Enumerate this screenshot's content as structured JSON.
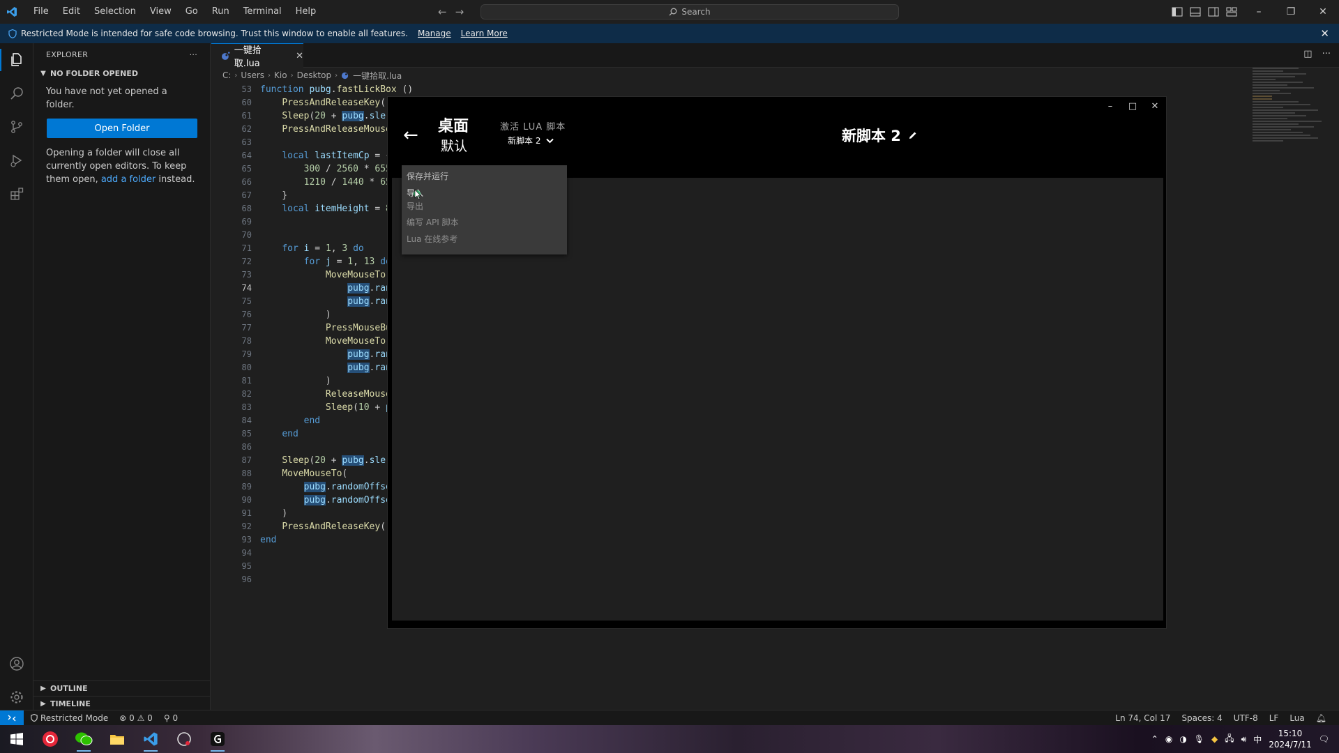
{
  "titlebar": {
    "menu": [
      "File",
      "Edit",
      "Selection",
      "View",
      "Go",
      "Run",
      "Terminal",
      "Help"
    ],
    "search_placeholder": "Search"
  },
  "banner": {
    "text": "Restricted Mode is intended for safe code browsing. Trust this window to enable all features.",
    "manage": "Manage",
    "learn_more": "Learn More"
  },
  "sidebar": {
    "title": "EXPLORER",
    "section": "NO FOLDER OPENED",
    "message": "You have not yet opened a folder.",
    "open_folder": "Open Folder",
    "note_before": "Opening a folder will close all currently open editors. To keep them open, ",
    "note_link": "add a folder",
    "note_after": " instead.",
    "outline": "OUTLINE",
    "timeline": "TIMELINE"
  },
  "editor": {
    "tab_label": "一键拾取.lua",
    "breadcrumb": [
      "C:",
      "Users",
      "Kio",
      "Desktop",
      "一键拾取.lua"
    ],
    "current_line": 74,
    "line_numbers": [
      53,
      60,
      61,
      62,
      63,
      64,
      65,
      66,
      67,
      68,
      69,
      70,
      71,
      72,
      73,
      74,
      75,
      76,
      77,
      78,
      79,
      80,
      81,
      82,
      83,
      84,
      85,
      86,
      87,
      88,
      89,
      90,
      91,
      92,
      93,
      94,
      95,
      96
    ]
  },
  "overlay": {
    "device": "桌面",
    "profile": "默认",
    "activate_label": "激活 LUA 脚本",
    "selected_script": "新脚本 2",
    "script_title": "新脚本 2",
    "menu_items": [
      "保存并运行",
      "导入",
      "导出",
      "编写 API 脚本",
      "Lua 在线参考"
    ]
  },
  "statusbar": {
    "restricted": "Restricted Mode",
    "errors": "0",
    "warnings": "0",
    "ports": "0",
    "position": "Ln 74, Col 17",
    "spaces": "Spaces: 4",
    "encoding": "UTF-8",
    "eol": "LF",
    "language": "Lua"
  },
  "taskbar": {
    "ime": "中",
    "time": "15:10",
    "date": "2024/7/11"
  },
  "colors": {
    "accent": "#0078d4",
    "banner_bg": "#0e2c48",
    "editor_bg": "#1f1f1f",
    "sidebar_bg": "#181818"
  }
}
